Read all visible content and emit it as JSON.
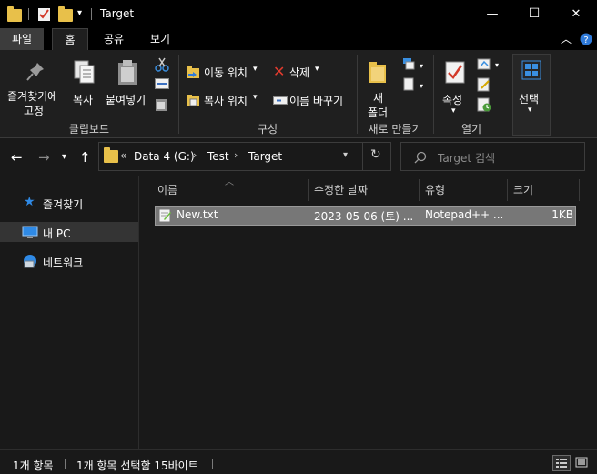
{
  "window": {
    "title": "Target",
    "minimize": "—",
    "maximize": "☐",
    "close": "✕"
  },
  "menu": {
    "tabs": [
      "파일",
      "홈",
      "공유",
      "보기"
    ],
    "active_tab": "홈"
  },
  "ribbon": {
    "pin_label_1": "즐겨찾기에",
    "pin_label_2": "고정",
    "copy": "복사",
    "paste": "붙여넣기",
    "move_to": "이동 위치",
    "copy_to": "복사 위치",
    "delete": "삭제",
    "rename": "이름 바꾸기",
    "new_folder_1": "새",
    "new_folder_2": "폴더",
    "properties": "속성",
    "select": "선택",
    "groups": {
      "clipboard": "클립보드",
      "organize": "구성",
      "new": "새로 만들기",
      "open": "열기"
    }
  },
  "address": {
    "chevron": "«",
    "segments": [
      "Data 4 (G:)",
      "Test",
      "Target"
    ],
    "search_placeholder": "Target 검색"
  },
  "nav": {
    "items": [
      "즐겨찾기",
      "내 PC",
      "네트워크"
    ],
    "selected": "내 PC"
  },
  "columns": {
    "name": "이름",
    "modified": "수정한 날짜",
    "type": "유형",
    "size": "크기"
  },
  "files": [
    {
      "name": "New.txt",
      "modified": "2023-05-06 (토) ...",
      "type": "Notepad++ ...",
      "size": "1KB"
    }
  ],
  "status": {
    "count": "1개 항목",
    "selection": "1개 항목 선택함 15바이트"
  },
  "colors": {
    "folder": "#e8c04a",
    "background": "#191919",
    "selected_row": "#777777"
  }
}
